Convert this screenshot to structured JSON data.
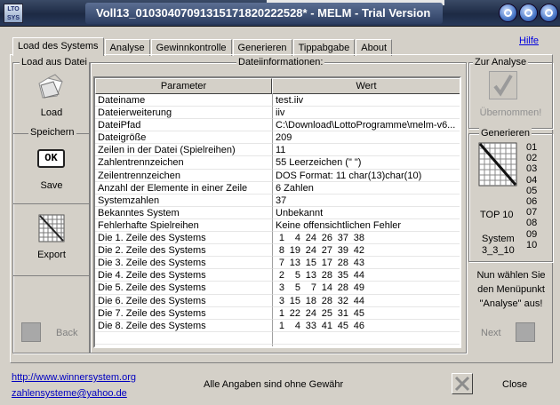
{
  "window": {
    "title": "Voll13_01030407091315171820222528* - MELM - Trial Version",
    "app_icon_text": "LTO SYS"
  },
  "help_label": "Hilfe",
  "tabs": [
    {
      "label": "Load des Systems"
    },
    {
      "label": "Analyse"
    },
    {
      "label": "Gewinnkontrolle"
    },
    {
      "label": "Generieren"
    },
    {
      "label": "Tippabgabe"
    },
    {
      "label": "About"
    }
  ],
  "left": {
    "group_title": "Load aus Datei",
    "load_label": "Load",
    "save_group_title": "Speichern",
    "ok_icon_text": "OK",
    "save_label": "Save",
    "export_label": "Export",
    "back_label": "Back"
  },
  "center": {
    "group_title": "Dateiinformationen:",
    "columns": [
      "Parameter",
      "Wert"
    ],
    "rows": [
      {
        "param": "Dateiname",
        "value": "test.iiv"
      },
      {
        "param": "Dateierweiterung",
        "value": "iiv"
      },
      {
        "param": "DateiPfad",
        "value": "C:\\Download\\LottoProgramme\\melm-v6..."
      },
      {
        "param": "Dateigröße",
        "value": "209"
      },
      {
        "param": "Zeilen in der Datei (Spielreihen)",
        "value": "11"
      },
      {
        "param": "Zahlentrennzeichen",
        "value": "55 Leerzeichen (\" \")"
      },
      {
        "param": "Zeilentrennzeichen",
        "value": "DOS Format: 11 char(13)char(10)"
      },
      {
        "param": "Anzahl der Elemente in einer Zeile",
        "value": "6 Zahlen"
      },
      {
        "param": "Systemzahlen",
        "value": "37"
      },
      {
        "param": "Bekanntes System",
        "value": "Unbekannt"
      },
      {
        "param": "Fehlerhafte Spielreihen",
        "value": "Keine offensichtlichen Fehler"
      }
    ],
    "system_rows": [
      {
        "param": "Die 1. Zeile des Systems",
        "numbers": [
          "1",
          "4",
          "24",
          "26",
          "37",
          "38"
        ]
      },
      {
        "param": "Die 2. Zeile des Systems",
        "numbers": [
          "8",
          "19",
          "24",
          "27",
          "39",
          "42"
        ]
      },
      {
        "param": "Die 3. Zeile des Systems",
        "numbers": [
          "7",
          "13",
          "15",
          "17",
          "28",
          "43"
        ]
      },
      {
        "param": "Die 4. Zeile des Systems",
        "numbers": [
          "2",
          "5",
          "13",
          "28",
          "35",
          "44"
        ]
      },
      {
        "param": "Die 5. Zeile des Systems",
        "numbers": [
          "3",
          "5",
          "7",
          "14",
          "28",
          "49"
        ]
      },
      {
        "param": "Die 6. Zeile des Systems",
        "numbers": [
          "3",
          "15",
          "18",
          "28",
          "32",
          "44"
        ]
      },
      {
        "param": "Die 7. Zeile des Systems",
        "numbers": [
          "1",
          "22",
          "24",
          "25",
          "31",
          "45"
        ]
      },
      {
        "param": "Die 8. Zeile des Systems",
        "numbers": [
          "1",
          "4",
          "33",
          "41",
          "45",
          "46"
        ]
      }
    ]
  },
  "right": {
    "analyse_group_title": "Zur Analyse",
    "uebernommen_label": "Übernommen!",
    "generate_group_title": "Generieren",
    "numbers": [
      "01",
      "02",
      "03",
      "04",
      "05",
      "06",
      "07",
      "08",
      "09",
      "10"
    ],
    "top_label": "TOP 10",
    "system_label": "System",
    "system_value": "3_3_10",
    "hint": "Nun wählen Sie den Menüpunkt \"Analyse\" aus!",
    "next_label": "Next"
  },
  "footer": {
    "website": "http://www.winnersystem.org",
    "email": "zahlensysteme@yahoo.de",
    "disclaimer": "Alle Angaben sind ohne Gewähr",
    "close_label": "Close"
  }
}
